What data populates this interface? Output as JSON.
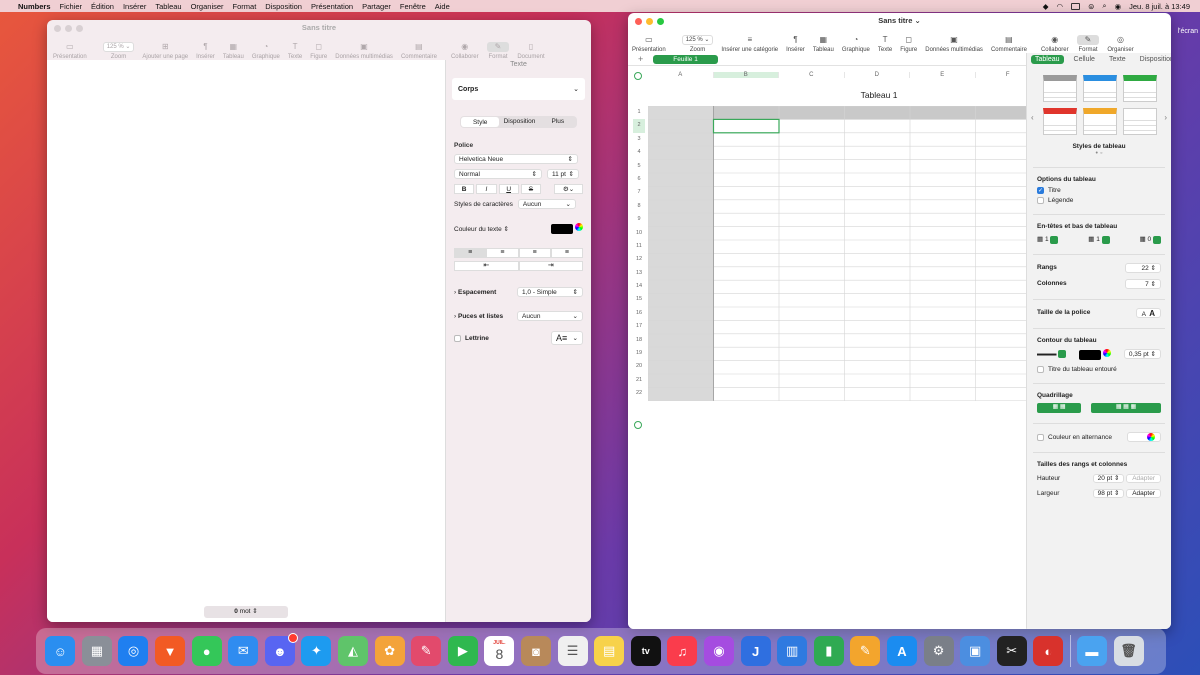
{
  "menubar": {
    "app": "Numbers",
    "items": [
      "Fichier",
      "Édition",
      "Insérer",
      "Tableau",
      "Organiser",
      "Format",
      "Disposition",
      "Présentation",
      "Partager",
      "Fenêtre",
      "Aide"
    ],
    "clock": "Jeu. 8 juil. à  13:49"
  },
  "desktop": {
    "partial_label": "l'écran"
  },
  "pages_window": {
    "title": "Sans titre",
    "toolbar": [
      {
        "label": "Présentation",
        "icon": "▭"
      },
      {
        "label": "Zoom",
        "value": "125 %"
      },
      {
        "label": "Ajouter une page",
        "icon": "⊞"
      },
      {
        "label": "Insérer",
        "icon": "¶"
      },
      {
        "label": "Tableau",
        "icon": "▦"
      },
      {
        "label": "Graphique",
        "icon": "◔"
      },
      {
        "label": "Texte",
        "icon": "T"
      },
      {
        "label": "Figure",
        "icon": "◻"
      },
      {
        "label": "Données multimédias",
        "icon": "▣"
      },
      {
        "label": "Commentaire",
        "icon": "▤"
      },
      {
        "label": "Collaborer",
        "icon": "◉"
      },
      {
        "label": "Format",
        "icon": "✎"
      },
      {
        "label": "Document",
        "icon": "▯"
      }
    ],
    "panel": {
      "title": "Texte",
      "paragraph_style": "Corps",
      "tabs": [
        "Style",
        "Disposition",
        "Plus"
      ],
      "police_label": "Police",
      "font": "Helvetica Neue",
      "weight": "Normal",
      "size": "11 pt",
      "format_buttons": [
        "B",
        "I",
        "U",
        "S"
      ],
      "char_styles_label": "Styles de caractères",
      "char_styles_value": "Aucun",
      "text_color_label": "Couleur du texte ⇕",
      "spacing_label": "Espacement",
      "spacing_value": "1,0 - Simple",
      "bullets_label": "Puces et listes",
      "bullets_value": "Aucun",
      "dropcap_label": "Lettrine"
    },
    "word_count": "0",
    "word_unit": "mot"
  },
  "numbers_window": {
    "title": "Sans titre",
    "toolbar": [
      {
        "label": "Présentation",
        "icon": "▭"
      },
      {
        "label": "Zoom",
        "value": "125 %"
      },
      {
        "label": "Insérer une catégorie",
        "icon": "≡"
      },
      {
        "label": "Insérer",
        "icon": "¶"
      },
      {
        "label": "Tableau",
        "icon": "▦"
      },
      {
        "label": "Graphique",
        "icon": "◔"
      },
      {
        "label": "Texte",
        "icon": "T"
      },
      {
        "label": "Figure",
        "icon": "◻"
      },
      {
        "label": "Données multimédias",
        "icon": "▣"
      },
      {
        "label": "Commentaire",
        "icon": "▤"
      },
      {
        "label": "Collaborer",
        "icon": "◉"
      },
      {
        "label": "Format",
        "icon": "✎"
      },
      {
        "label": "Organiser",
        "icon": "◎"
      }
    ],
    "sheet_tab": "Feuille 1",
    "columns": [
      "A",
      "B",
      "C",
      "D",
      "E",
      "F"
    ],
    "table_title": "Tableau 1",
    "rows": 22,
    "inspector": {
      "tabs": [
        "Tableau",
        "Cellule",
        "Texte",
        "Disposition"
      ],
      "styles_label": "Styles de tableau",
      "options_label": "Options du tableau",
      "opt_title": "Titre",
      "opt_legend": "Légende",
      "headers_label": "En-têtes et bas de tableau",
      "hdr_rows": "1",
      "hdr_cols": "1",
      "footer_rows": "0",
      "rows_label": "Rangs",
      "rows_value": "22",
      "cols_label": "Colonnes",
      "cols_value": "7",
      "fontsize_label": "Taille de la police",
      "outline_label": "Contour du tableau",
      "outline_value": "0,35 pt",
      "outline_title_label": "Titre du tableau entouré",
      "grid_label": "Quadrillage",
      "alt_color_label": "Couleur en alternance",
      "sizes_label": "Tailles des rangs et colonnes",
      "height_label": "Hauteur",
      "height_value": "20 pt",
      "width_label": "Largeur",
      "width_value": "98 pt",
      "adjust": "Adapter"
    }
  },
  "dock": [
    {
      "name": "finder-icon",
      "color": "#2a8ef0",
      "g": "☺"
    },
    {
      "name": "launchpad-icon",
      "color": "#8a8f98",
      "g": "▦"
    },
    {
      "name": "safari-icon",
      "color": "#1f7ff0",
      "g": "◎"
    },
    {
      "name": "brave-icon",
      "color": "#f25a24",
      "g": "▼"
    },
    {
      "name": "messages-icon",
      "color": "#34c759",
      "g": "●"
    },
    {
      "name": "mail-icon",
      "color": "#2f8cf0",
      "g": "✉"
    },
    {
      "name": "discord-icon",
      "color": "#5865f2",
      "g": "☻",
      "badge": true
    },
    {
      "name": "twitter-icon",
      "color": "#1d9bf0",
      "g": "✦"
    },
    {
      "name": "maps-icon",
      "color": "#5fc46a",
      "g": "◭"
    },
    {
      "name": "photos-icon",
      "color": "#f3a33a",
      "g": "✿"
    },
    {
      "name": "pixelmator-icon",
      "color": "#e24a6c",
      "g": "✎"
    },
    {
      "name": "facetime-icon",
      "color": "#2fb84f",
      "g": "▶"
    },
    {
      "name": "calendar-icon",
      "color": "#ffffff",
      "g": "8",
      "month": "JUIL."
    },
    {
      "name": "contacts-icon",
      "color": "#b8895a",
      "g": "◙"
    },
    {
      "name": "reminders-icon",
      "color": "#f0f0f0",
      "g": "☰"
    },
    {
      "name": "notes-icon",
      "color": "#f7d24a",
      "g": "▤"
    },
    {
      "name": "appletv-icon",
      "color": "#111111",
      "g": "tv"
    },
    {
      "name": "music-icon",
      "color": "#fa3c4c",
      "g": "♫"
    },
    {
      "name": "podcasts-icon",
      "color": "#a54ce0",
      "g": "◉"
    },
    {
      "name": "jellyfin-icon",
      "color": "#2f6fe0",
      "g": "J"
    },
    {
      "name": "keynote-icon",
      "color": "#2f7ae0",
      "g": "▥"
    },
    {
      "name": "numbers-icon",
      "color": "#2faa52",
      "g": "▮"
    },
    {
      "name": "pages-icon",
      "color": "#f3a52d",
      "g": "✎"
    },
    {
      "name": "appstore-icon",
      "color": "#1b8cf0",
      "g": "A"
    },
    {
      "name": "preferences-icon",
      "color": "#7a7f88",
      "g": "⚙"
    },
    {
      "name": "preview-icon",
      "color": "#4c8ee0",
      "g": "▣"
    },
    {
      "name": "finalcut-icon",
      "color": "#222222",
      "g": "✂"
    },
    {
      "name": "photobooth-icon",
      "color": "#d8322c",
      "g": "◐"
    },
    {
      "name": "folder-icon",
      "color": "#4aa3f0",
      "g": "▬"
    },
    {
      "name": "trash-icon",
      "color": "#d8dde3",
      "g": "🗑"
    }
  ]
}
